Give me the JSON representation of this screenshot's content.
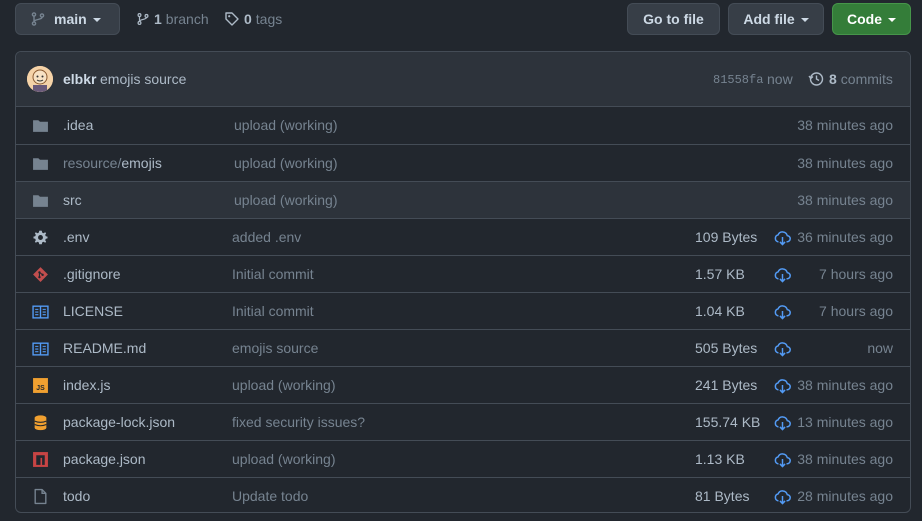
{
  "toolbar": {
    "branch_button": "main",
    "branch_count": "1",
    "branch_label": "branch",
    "tag_count": "0",
    "tag_label": "tags",
    "goto_file": "Go to file",
    "add_file": "Add file",
    "code": "Code"
  },
  "commit": {
    "author": "elbkr",
    "message": "emojis source",
    "sha": "81558fa",
    "when": "now",
    "count": "8",
    "count_label": "commits"
  },
  "colors": {
    "folder": "#768390",
    "git": "#c24e4e",
    "js": "#f0a030",
    "db": "#f0a030",
    "npm": "#c74444",
    "book": "#539bf5",
    "download": "#539bf5",
    "code_green": "#347d39"
  },
  "files": [
    {
      "icon": "folder-icon",
      "name": ".idea",
      "message": "upload (working)",
      "size": "",
      "time": "38 minutes ago",
      "folder": true
    },
    {
      "icon": "folder-icon",
      "name_prefix": "resource/",
      "name": "emojis",
      "message": "upload (working)",
      "size": "",
      "time": "38 minutes ago",
      "folder": true
    },
    {
      "icon": "folder-icon",
      "name": "src",
      "message": "upload (working)",
      "size": "",
      "time": "38 minutes ago",
      "folder": true
    },
    {
      "icon": "gear-icon",
      "name": ".env",
      "message": "added .env",
      "size": "109 Bytes",
      "time": "36 minutes ago"
    },
    {
      "icon": "git-icon",
      "name": ".gitignore",
      "message": "Initial commit",
      "size": "1.57 KB",
      "time": "7 hours ago"
    },
    {
      "icon": "book-icon",
      "name": "LICENSE",
      "message": "Initial commit",
      "size": "1.04 KB",
      "time": "7 hours ago"
    },
    {
      "icon": "book-icon",
      "name": "README.md",
      "message": "emojis source",
      "size": "505 Bytes",
      "time": "now"
    },
    {
      "icon": "js-icon",
      "name": "index.js",
      "message": "upload (working)",
      "size": "241 Bytes",
      "time": "38 minutes ago"
    },
    {
      "icon": "database-icon",
      "name": "package-lock.json",
      "message": "fixed security issues?",
      "size": "155.74 KB",
      "time": "13 minutes ago"
    },
    {
      "icon": "npm-icon",
      "name": "package.json",
      "message": "upload (working)",
      "size": "1.13 KB",
      "time": "38 minutes ago"
    },
    {
      "icon": "file-icon",
      "name": "todo",
      "message": "Update todo",
      "size": "81 Bytes",
      "time": "28 minutes ago"
    }
  ]
}
